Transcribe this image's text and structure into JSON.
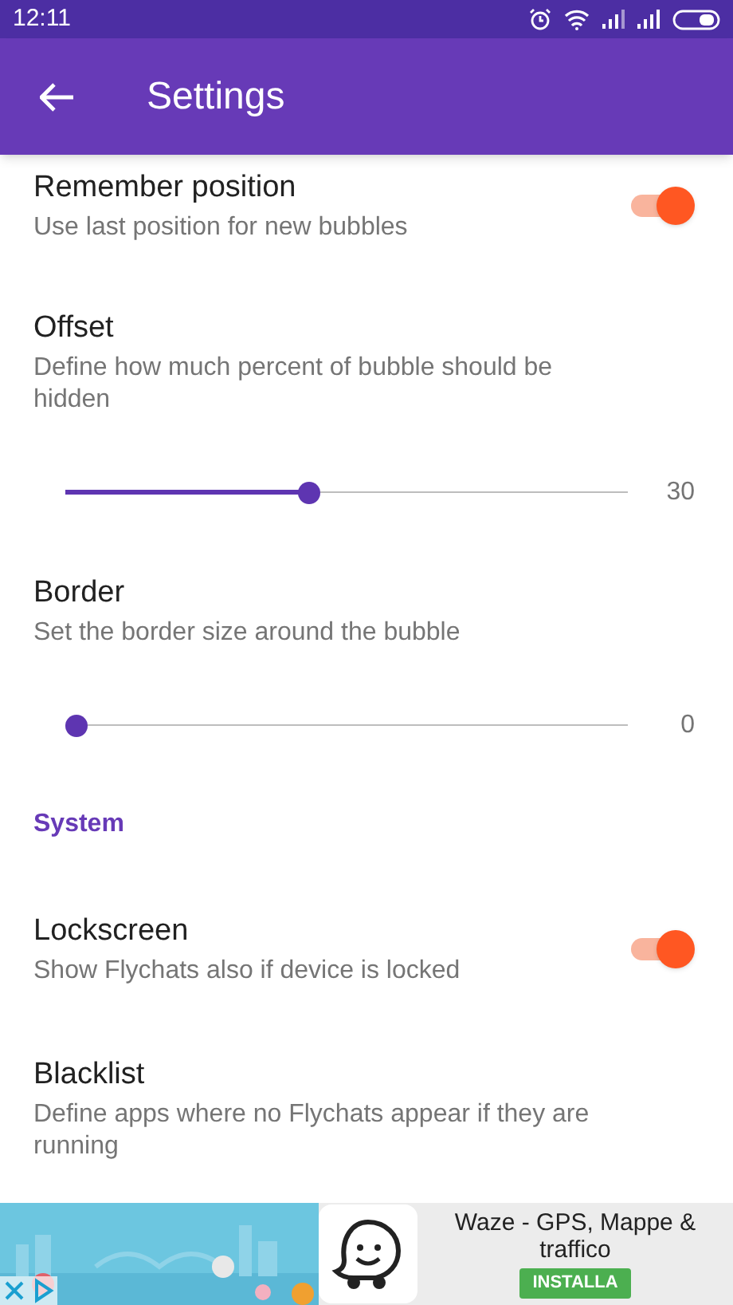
{
  "status_bar": {
    "time": "12:11"
  },
  "app_bar": {
    "title": "Settings"
  },
  "settings": [
    {
      "kind": "toggle",
      "title": "Remember position",
      "summary": "Use last position for new bubbles",
      "on": true
    },
    {
      "kind": "slider",
      "title": "Offset",
      "summary": "Define how much percent of bubble should be hidden",
      "level": 0.43,
      "reading": "30"
    },
    {
      "kind": "slider",
      "title": "Border",
      "summary": "Set the border size around the bubble",
      "level": 0,
      "reading": "0"
    },
    {
      "kind": "header",
      "title": "System"
    },
    {
      "kind": "toggle",
      "title": "Lockscreen",
      "summary": "Show Flychats also if device is locked",
      "on": true
    },
    {
      "kind": "plain",
      "title": "Blacklist",
      "summary": "Define apps where no Flychats appear if they are running"
    }
  ],
  "ad": {
    "kind": "picture",
    "title": "Waze - GPS, Mappe & traffico",
    "button": "INSTALLA"
  }
}
